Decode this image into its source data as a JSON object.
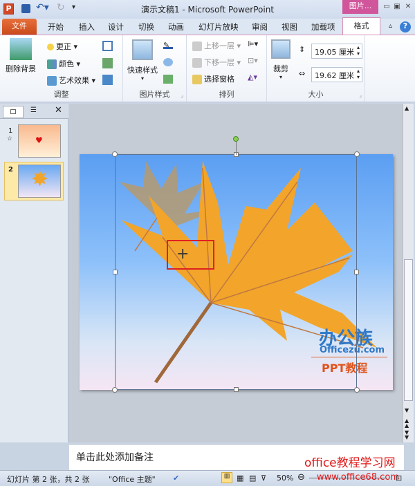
{
  "window": {
    "title": "演示文稿1 - Microsoft PowerPoint",
    "context_tab": "图片...",
    "app_icon": "P"
  },
  "tabs": [
    "文件",
    "开始",
    "插入",
    "设计",
    "切换",
    "动画",
    "幻灯片放映",
    "审阅",
    "视图",
    "加载项",
    "格式"
  ],
  "ribbon": {
    "adjust": {
      "label": "调整",
      "remove_bg": "删除背景",
      "corrections": "更正",
      "color": "颜色",
      "artistic": "艺术效果"
    },
    "styles": {
      "label": "图片样式",
      "quick_styles": "快速样式"
    },
    "arrange": {
      "label": "排列",
      "bring_forward": "上移一层",
      "send_backward": "下移一层",
      "selection_pane": "选择窗格"
    },
    "size": {
      "label": "大小",
      "crop": "裁剪",
      "height": "19.05 厘米",
      "width": "19.62 厘米"
    }
  },
  "slides": [
    {
      "number": "1"
    },
    {
      "number": "2"
    }
  ],
  "slide": {
    "logo_cn": "办公族",
    "logo_url": "Officezu.com",
    "logo_sub": "PPT教程"
  },
  "notes": {
    "placeholder": "单击此处添加备注"
  },
  "watermark": {
    "line1": "office教程学习网",
    "line2": "www.office68.com"
  },
  "status": {
    "slide_info": "幻灯片 第 2 张，共 2 张",
    "theme": "\"Office 主题\"",
    "zoom": "50%"
  },
  "colors": {
    "accent": "#d0559a",
    "file_tab": "#d9561f",
    "leaf": "#f2a52a",
    "selection_box": "#e02020"
  }
}
